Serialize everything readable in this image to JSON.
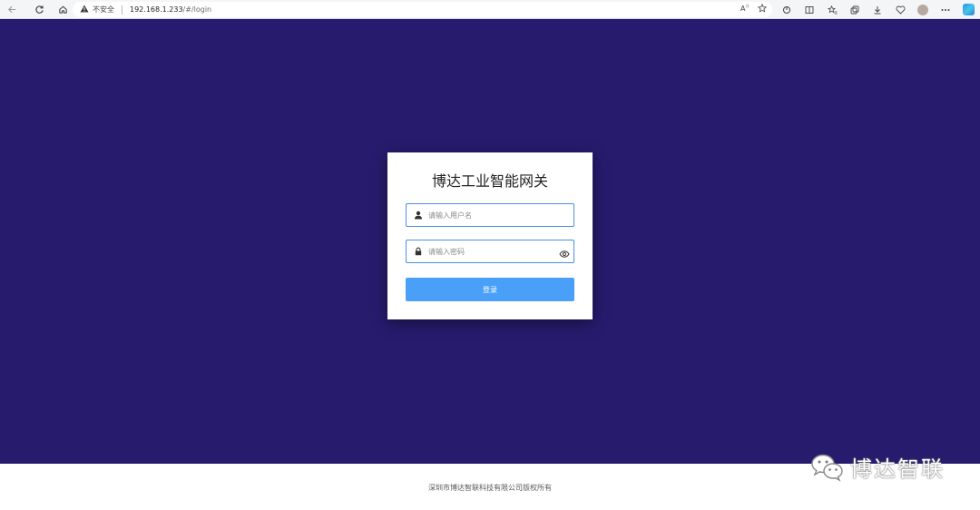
{
  "browser": {
    "security_label": "不安全",
    "url_host": "192.168.1.233",
    "url_path": "/#/login"
  },
  "login": {
    "title": "博达工业智能网关",
    "username_placeholder": "请输入用户名",
    "password_placeholder": "请输入密码",
    "submit_label": "登录"
  },
  "footer": {
    "copyright": "深圳市博达智联科技有限公司版权所有"
  },
  "watermark": {
    "text": "博达智联"
  },
  "colors": {
    "background": "#271b6e",
    "accent": "#4aa0f8",
    "field_border": "#4a8fe3"
  },
  "icons": [
    "back-icon",
    "refresh-icon",
    "home-icon",
    "warning-icon",
    "read-aloud-icon",
    "favorite-icon",
    "extensions-icon",
    "split-screen-icon",
    "favorites-icon",
    "collections-icon",
    "download-icon",
    "browser-essentials-icon",
    "profile-icon",
    "copilot-icon",
    "user-icon",
    "lock-icon",
    "eye-icon",
    "wechat-icon"
  ]
}
